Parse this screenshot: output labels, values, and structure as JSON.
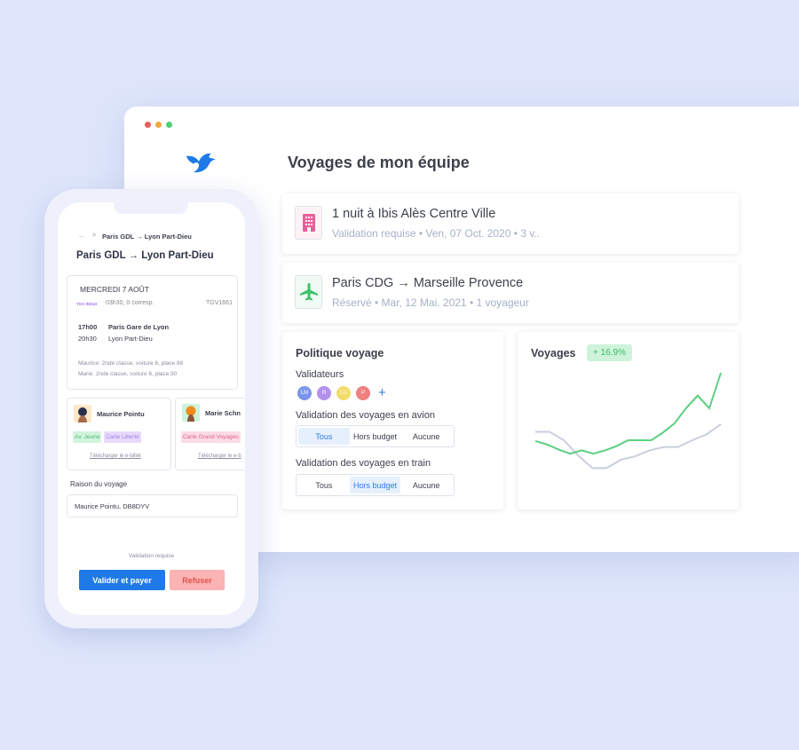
{
  "window": {
    "dots": [
      "#ef5b5b",
      "#f4a63b",
      "#4fcf79"
    ],
    "title": "Voyages de mon équipe"
  },
  "trips": [
    {
      "icon": "building-icon",
      "title": "1 nuit à Ibis Alès Centre Ville",
      "subtitle": "Validation requise • Ven, 07 Oct. 2020 • 3 v.."
    },
    {
      "icon": "plane-icon",
      "title": "Paris CDG → Marseille Provence",
      "subtitle": "Réservé • Mar, 12 Mai. 2021 • 1 voyageur"
    }
  ],
  "policy": {
    "title": "Politique voyage",
    "validators_label": "Validateurs",
    "validators": [
      {
        "initials": "LM",
        "color": "#7b95ea"
      },
      {
        "initials": "R",
        "color": "#b392ee"
      },
      {
        "initials": "LU",
        "color": "#f2dc6a"
      },
      {
        "initials": "P",
        "color": "#f08080"
      }
    ],
    "plane_label": "Validation des voyages en avion",
    "train_label": "Validation des voyages en train",
    "options": [
      "Tous",
      "Hors budget",
      "Aucune"
    ],
    "plane_selected": "Tous",
    "train_selected": "Hors budget"
  },
  "chart_data": {
    "type": "line",
    "title": "Voyages",
    "badge": "+ 16.9%",
    "grid": false,
    "series": [
      {
        "color": "#5ccf80",
        "values": [
          39,
          35,
          29,
          24,
          28,
          24,
          28,
          33,
          40,
          40,
          40,
          49,
          60,
          78,
          93,
          78,
          120
        ]
      },
      {
        "color": "#c9cfdd",
        "values": [
          50,
          50,
          40,
          22,
          7,
          7,
          17,
          21,
          28,
          32,
          32,
          40,
          47,
          59
        ]
      }
    ]
  },
  "phone": {
    "breadcrumb_ellipsis": "...",
    "breadcrumb_sep": ">",
    "breadcrumb": "Paris GDL → Lyon Part-Dieu",
    "title": "Paris GDL → Lyon Part-Dieu",
    "date": "MERCREDI 7 AOÛT",
    "operator": "TGV INOUI",
    "duration": "03h30, 0 corresp.",
    "train": "TGV1661",
    "dep_time": "17h00",
    "dep_station": "Paris Gare de Lyon",
    "arr_time": "20h30",
    "arr_station": "Lyon Part-Dieu",
    "seat1": "Maurice: 2nde classe, voiture 6, place 88",
    "seat2": "Marie: 2nde classe, voiture 6, place 90",
    "travelers": [
      {
        "name": "Maurice Pointu",
        "tags": [
          {
            "label": "Av. Jeune",
            "bg": "#d2f4dd",
            "fg": "#4cbc72"
          },
          {
            "label": "Carte Liberté",
            "bg": "#e7dafb",
            "fg": "#a27ee6"
          }
        ],
        "link": "Télécharger le e-billet"
      },
      {
        "name": "Marie Schn",
        "tags": [
          {
            "label": "Carte Grand Voyageu",
            "bg": "#fcdbe6",
            "fg": "#e0608c"
          }
        ],
        "link": "Télécharger le e-b"
      }
    ],
    "reason_label": "Raison du voyage",
    "reason_value": "Maurice Pointu, DB8DYV",
    "status": "Validation requise",
    "validate": "Valider et payer",
    "refuse": "Refuser"
  }
}
